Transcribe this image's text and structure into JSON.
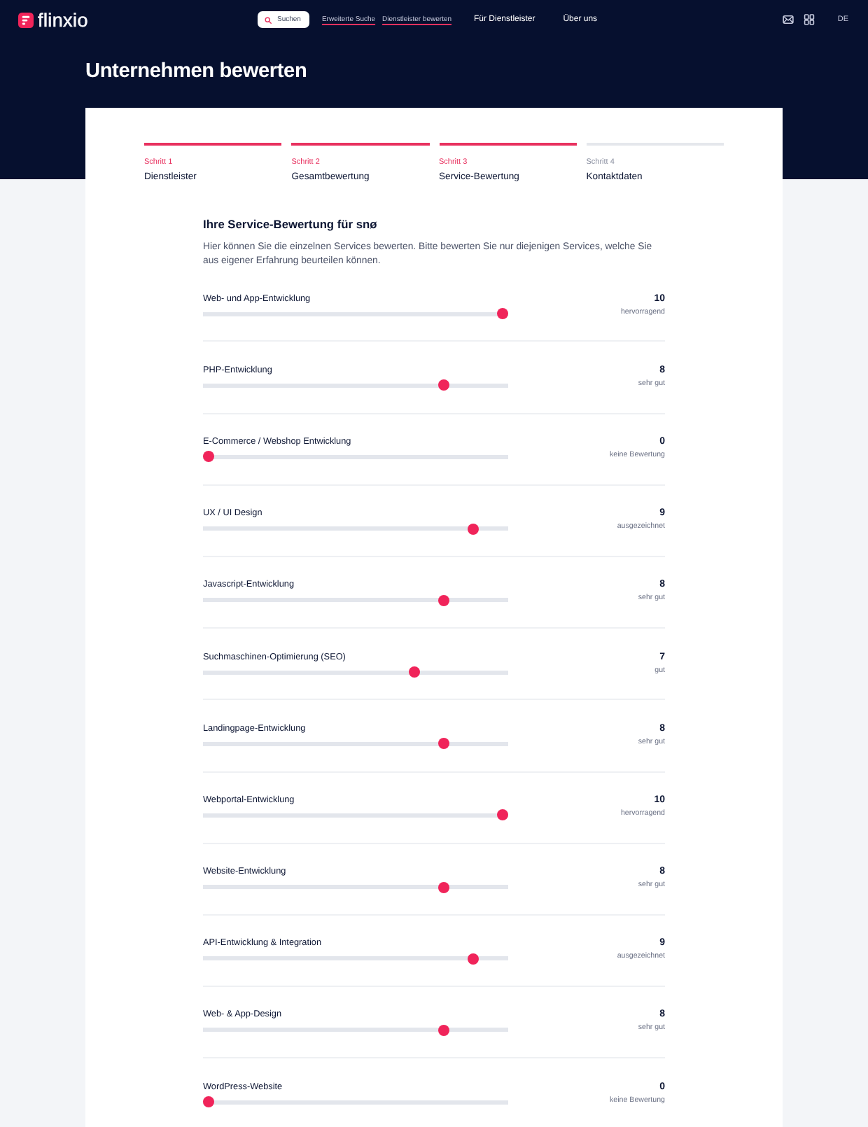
{
  "header": {
    "logo": "flinxio",
    "search_button": "Suchen",
    "links": [
      "Erweiterte Suche",
      "Dienstleister bewerten"
    ],
    "nav": [
      "Für Dienstleister",
      "Über uns"
    ],
    "language": {
      "label": "DE",
      "selected": true
    }
  },
  "page_title": "Unternehmen bewerten",
  "steps": [
    {
      "step": "Schritt 1",
      "name": "Dienstleister",
      "completed": true
    },
    {
      "step": "Schritt 2",
      "name": "Gesamtbewertung",
      "completed": true
    },
    {
      "step": "Schritt 3",
      "name": "Service-Bewertung",
      "completed": true
    },
    {
      "step": "Schritt 4",
      "name": "Kontaktdaten",
      "completed": false
    }
  ],
  "section": {
    "title": "Ihre Service-Bewertung für snø",
    "description": "Hier können Sie die einzelnen Services bewerten. Bitte bewerten Sie nur diejenigen Services, welche Sie aus eigener Erfahrung beurteilen können."
  },
  "ratings": [
    {
      "service": "Web- und App-Entwicklung",
      "level": 1,
      "score": "10",
      "verdict": "hervorragend"
    },
    {
      "service": "PHP-Entwicklung",
      "level": 0.8,
      "score": "8",
      "verdict": "sehr gut"
    },
    {
      "service": "E-Commerce / Webshop Entwicklung",
      "level": 0,
      "score": "0",
      "verdict": "keine Bewertung"
    },
    {
      "service": "UX / UI Design",
      "level": 0.9,
      "score": "9",
      "verdict": "ausgezeichnet"
    },
    {
      "service": "Javascript-Entwicklung",
      "level": 0.8,
      "score": "8",
      "verdict": "sehr gut"
    },
    {
      "service": "Suchmaschinen-Optimierung (SEO)",
      "level": 0.7,
      "score": "7",
      "verdict": "gut"
    },
    {
      "service": "Landingpage-Entwicklung",
      "level": 0.8,
      "score": "8",
      "verdict": "sehr gut"
    },
    {
      "service": "Webportal-Entwicklung",
      "level": 1,
      "score": "10",
      "verdict": "hervorragend"
    },
    {
      "service": "Website-Entwicklung",
      "level": 0.8,
      "score": "8",
      "verdict": "sehr gut"
    },
    {
      "service": "API-Entwicklung & Integration",
      "level": 0.9,
      "score": "9",
      "verdict": "ausgezeichnet"
    },
    {
      "service": "Web- & App-Design",
      "level": 0.8,
      "score": "8",
      "verdict": "sehr gut"
    },
    {
      "service": "WordPress-Website",
      "level": 0,
      "score": "0",
      "verdict": "keine Bewertung"
    }
  ]
}
